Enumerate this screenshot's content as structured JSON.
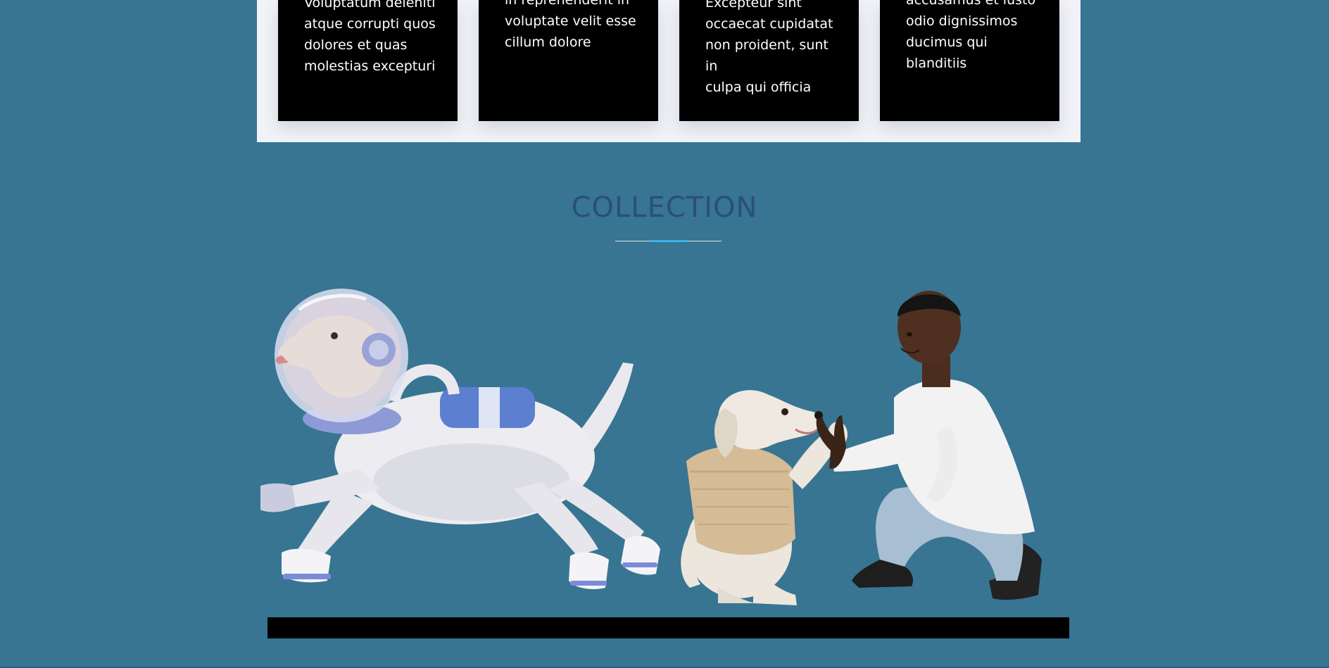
{
  "features": {
    "cards": [
      {
        "text": "Voluptatum deleniti\natque corrupti quos\ndolores et quas\nmolestias excepturi"
      },
      {
        "text": "in reprehenderit in\nvoluptate velit esse\ncillum dolore"
      },
      {
        "text": "Excepteur sint\noccaecat cupidatat\nnon proident, sunt in\nculpa qui officia"
      },
      {
        "text": "accusamus et iusto\nodio dignissimos\nducimus qui\nblanditiis"
      }
    ]
  },
  "collection": {
    "title": "COLLECTION"
  },
  "colors": {
    "background": "#377592",
    "panel": "#f2f3f8",
    "title": "#2b4e7d",
    "accent": "#38b3ea"
  }
}
